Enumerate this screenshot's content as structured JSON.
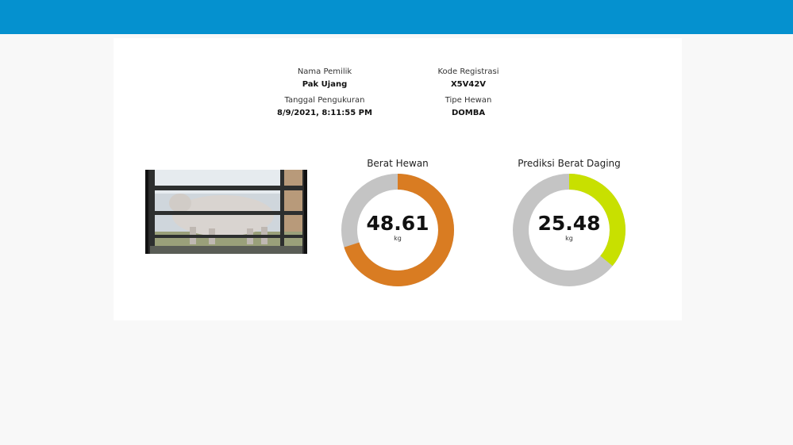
{
  "header": {
    "bar_color": "#0591cf"
  },
  "info": {
    "owner_label": "Nama Pemilik",
    "owner_value": "Pak Ujang",
    "registration_label": "Kode Registrasi",
    "registration_value": "X5V42V",
    "date_label": "Tanggal Pengukuran",
    "date_value": "8/9/2021, 8:11:55 PM",
    "type_label": "Tipe Hewan",
    "type_value": "DOMBA"
  },
  "photo": {
    "description_icon": "sheep-photo"
  },
  "gauges": [
    {
      "title": "Berat Hewan",
      "value": "48.61",
      "unit": "kg",
      "fill_fraction": 0.7,
      "fill_color": "#d97c22",
      "track_color": "#c4c4c4"
    },
    {
      "title": "Prediksi Berat Daging",
      "value": "25.48",
      "unit": "kg",
      "fill_fraction": 0.36,
      "fill_color": "#c8e000",
      "track_color": "#c4c4c4"
    }
  ]
}
